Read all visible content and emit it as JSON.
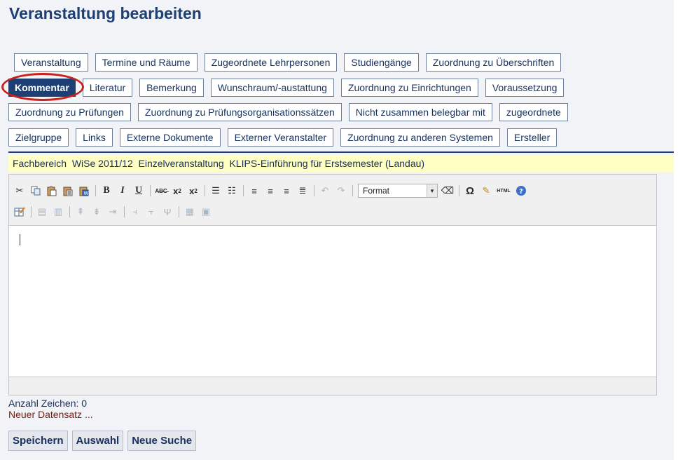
{
  "page": {
    "title": "Veranstaltung bearbeiten"
  },
  "tabs": {
    "row1": [
      "Veranstaltung",
      "Termine und Räume",
      "Zugeordnete Lehrpersonen",
      "Studiengänge",
      "Zuordnung zu Überschriften"
    ],
    "row2": [
      "Kommentar",
      "Literatur",
      "Bemerkung",
      "Wunschraum/-austattung",
      "Zuordnung zu Einrichtungen",
      "Voraussetzung"
    ],
    "row3": [
      "Zuordnung zu Prüfungen",
      "Zuordnung zu Prüfungsorganisationssätzen",
      "Nicht zusammen belegbar mit",
      "zugeordnete"
    ],
    "row4": [
      "Zielgruppe",
      "Links",
      "Externe Dokumente",
      "Externer Veranstalter",
      "Zuordnung zu anderen Systemen",
      "Ersteller"
    ],
    "active": "Kommentar"
  },
  "info_bar": {
    "text": "Fachbereich  WiSe 2011/12  Einzelveranstaltung  KLIPS-Einführung für Erstsemester (Landau)"
  },
  "editor": {
    "toolbar_row1": [
      "cut-icon",
      "copy-icon",
      "paste-icon",
      "paste-text-icon",
      "paste-word-icon",
      "bold-icon",
      "italic-icon",
      "underline-icon",
      "spellcheck-icon",
      "subscript-icon",
      "superscript-icon",
      "bullet-list-icon",
      "numbered-list-icon",
      "align-left-icon",
      "align-center-icon",
      "align-right-icon",
      "justify-icon",
      "undo-icon",
      "redo-icon",
      "eraser-icon",
      "omega-icon",
      "cleanup-icon",
      "html-icon",
      "help-icon"
    ],
    "format_label": "Format",
    "html_label": "HTML",
    "toolbar_row2": [
      "table-edit-icon",
      "table-row-props-icon",
      "table-cell-props-icon",
      "insert-row-before-icon",
      "insert-row-after-icon",
      "delete-row-icon",
      "insert-col-before-icon",
      "insert-col-after-icon",
      "delete-col-icon",
      "split-cells-icon",
      "merge-cells-icon"
    ],
    "content": ""
  },
  "status": {
    "char_count": "Anzahl Zeichen: 0",
    "new_record": "Neuer Datensatz ..."
  },
  "buttons": {
    "save": "Speichern",
    "select": "Auswahl",
    "new_search": "Neue Suche"
  },
  "colors": {
    "accent": "#1e3f74",
    "info_bar_bg": "#ffffc4",
    "highlight_circle": "#c8211e",
    "new_record_text": "#7a1b14"
  }
}
